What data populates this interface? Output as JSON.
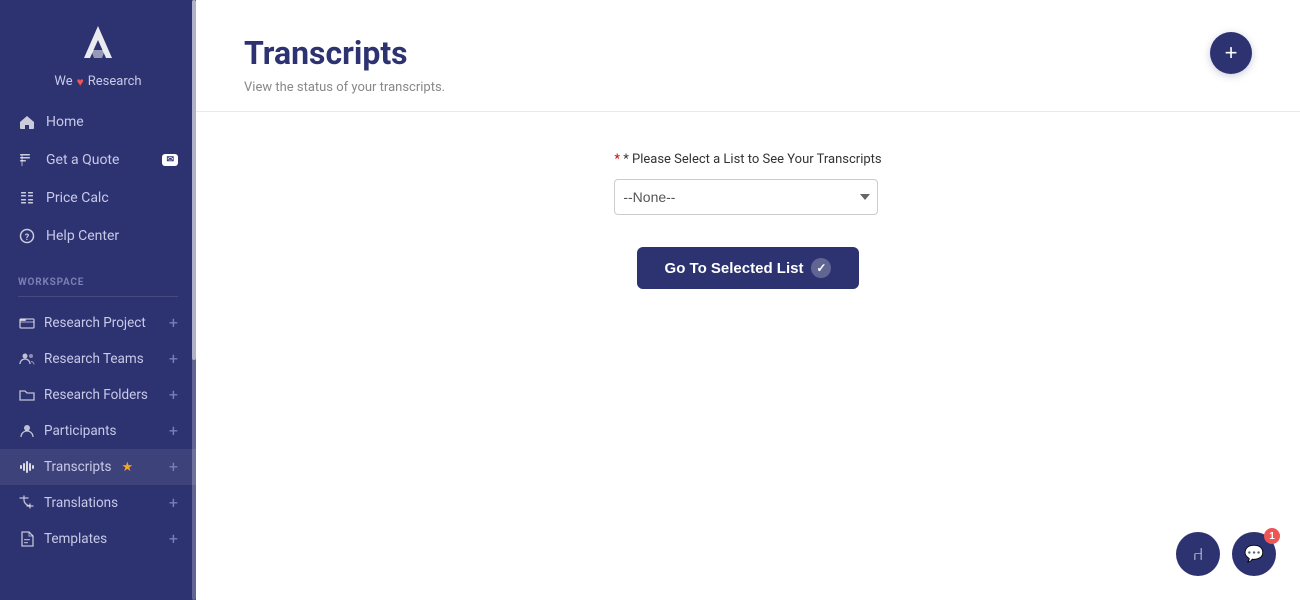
{
  "sidebar": {
    "logo_text_part1": "We",
    "logo_text_heart": "♥",
    "logo_text_part2": "Research",
    "nav_items": [
      {
        "id": "home",
        "label": "Home",
        "icon": "home-icon"
      },
      {
        "id": "get-a-quote",
        "label": "Get a Quote",
        "icon": "quote-icon",
        "badge": true
      },
      {
        "id": "price-calc",
        "label": "Price Calc",
        "icon": "calc-icon"
      },
      {
        "id": "help-center",
        "label": "Help Center",
        "icon": "help-icon"
      }
    ],
    "workspace_label": "WORKSPACE",
    "workspace_items": [
      {
        "id": "research-project",
        "label": "Research Project",
        "icon": "folder-open-icon",
        "plus": true
      },
      {
        "id": "research-teams",
        "label": "Research Teams",
        "icon": "people-icon",
        "plus": true
      },
      {
        "id": "research-folders",
        "label": "Research Folders",
        "icon": "folder-icon",
        "plus": true
      },
      {
        "id": "participants",
        "label": "Participants",
        "icon": "person-icon",
        "plus": true
      },
      {
        "id": "transcripts",
        "label": "Transcripts",
        "icon": "waveform-icon",
        "star": true,
        "plus": true
      },
      {
        "id": "translations",
        "label": "Translations",
        "icon": "translate-icon",
        "plus": true
      },
      {
        "id": "templates",
        "label": "Templates",
        "icon": "file-icon",
        "plus": true
      }
    ]
  },
  "main": {
    "page_title": "Transcripts",
    "page_subtitle": "View the status of your transcripts.",
    "add_button_label": "+",
    "select_label": "* Please Select a List to See Your Transcripts",
    "select_placeholder": "--None--",
    "select_options": [
      "--None--"
    ],
    "go_button_label": "Go To Selected List",
    "go_button_check": "✓"
  },
  "bottom_right": {
    "accessibility_icon": "♿",
    "chat_icon": "💬",
    "chat_badge": "1"
  }
}
